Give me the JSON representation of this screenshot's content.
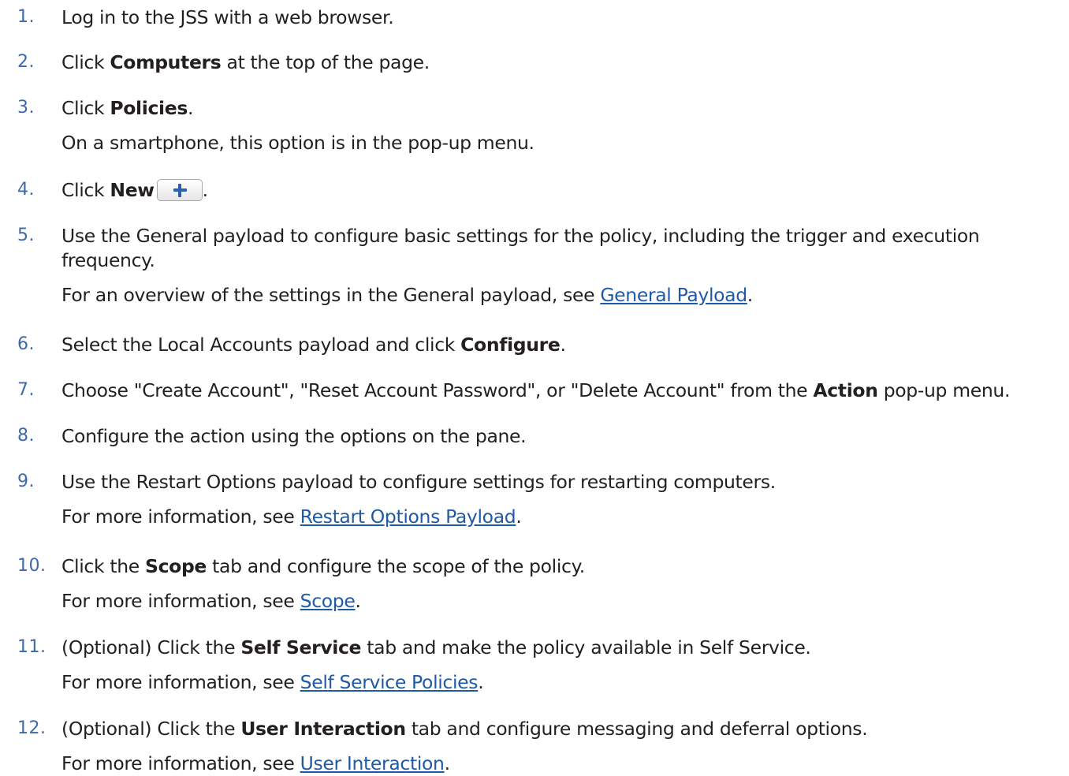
{
  "steps": [
    {
      "num": "1.",
      "pre": "Log in to the JSS with a web browser."
    },
    {
      "num": "2.",
      "pre": "Click ",
      "bold": "Computers",
      "post": " at the top of the page."
    },
    {
      "num": "3.",
      "pre": "Click ",
      "bold": "Policies",
      "post": ".",
      "note": "On a smartphone, this option is in the pop-up menu."
    },
    {
      "num": "4.",
      "pre": "Click ",
      "bold": "New",
      "post": "."
    },
    {
      "num": "5.",
      "line1": "Use the General payload to configure basic settings for the policy, including the trigger and execution",
      "line2": "frequency.",
      "note_pre": "For an overview of the settings in the General payload, see ",
      "link": "General Payload",
      "note_post": "."
    },
    {
      "num": "6.",
      "pre": "Select the Local Accounts payload and click ",
      "bold": "Configure",
      "post": "."
    },
    {
      "num": "7.",
      "pre": "Choose \"Create Account\", \"Reset Account Password\", or \"Delete Account\" from the ",
      "bold": "Action",
      "post": " pop-up menu."
    },
    {
      "num": "8.",
      "pre": "Configure the action using the options on the pane."
    },
    {
      "num": "9.",
      "pre": "Use the Restart Options payload to configure settings for restarting computers.",
      "note_pre": "For more information, see ",
      "link": "Restart Options Payload",
      "note_post": "."
    },
    {
      "num": "10.",
      "pre": "Click the ",
      "bold": "Scope",
      "post": " tab and configure the scope of the policy.",
      "note_pre": "For more information, see ",
      "link": "Scope",
      "note_post": "."
    },
    {
      "num": "11.",
      "pre": "(Optional) Click the ",
      "bold": "Self Service",
      "post": " tab and make the policy available in Self Service.",
      "note_pre": "For more information, see ",
      "link": "Self Service Policies",
      "note_post": "."
    },
    {
      "num": "12.",
      "pre": "(Optional) Click the ",
      "bold": "User Interaction",
      "post": " tab and configure messaging and deferral options.",
      "note_pre": "For more information, see ",
      "link": "User Interaction",
      "note_post": "."
    }
  ],
  "icons": {
    "new_button": "plus-icon",
    "new_button_color": "#2b5fb0"
  },
  "colors": {
    "step_number": "#3d6aa8",
    "link": "#1f5aa6",
    "text": "#231f20"
  }
}
